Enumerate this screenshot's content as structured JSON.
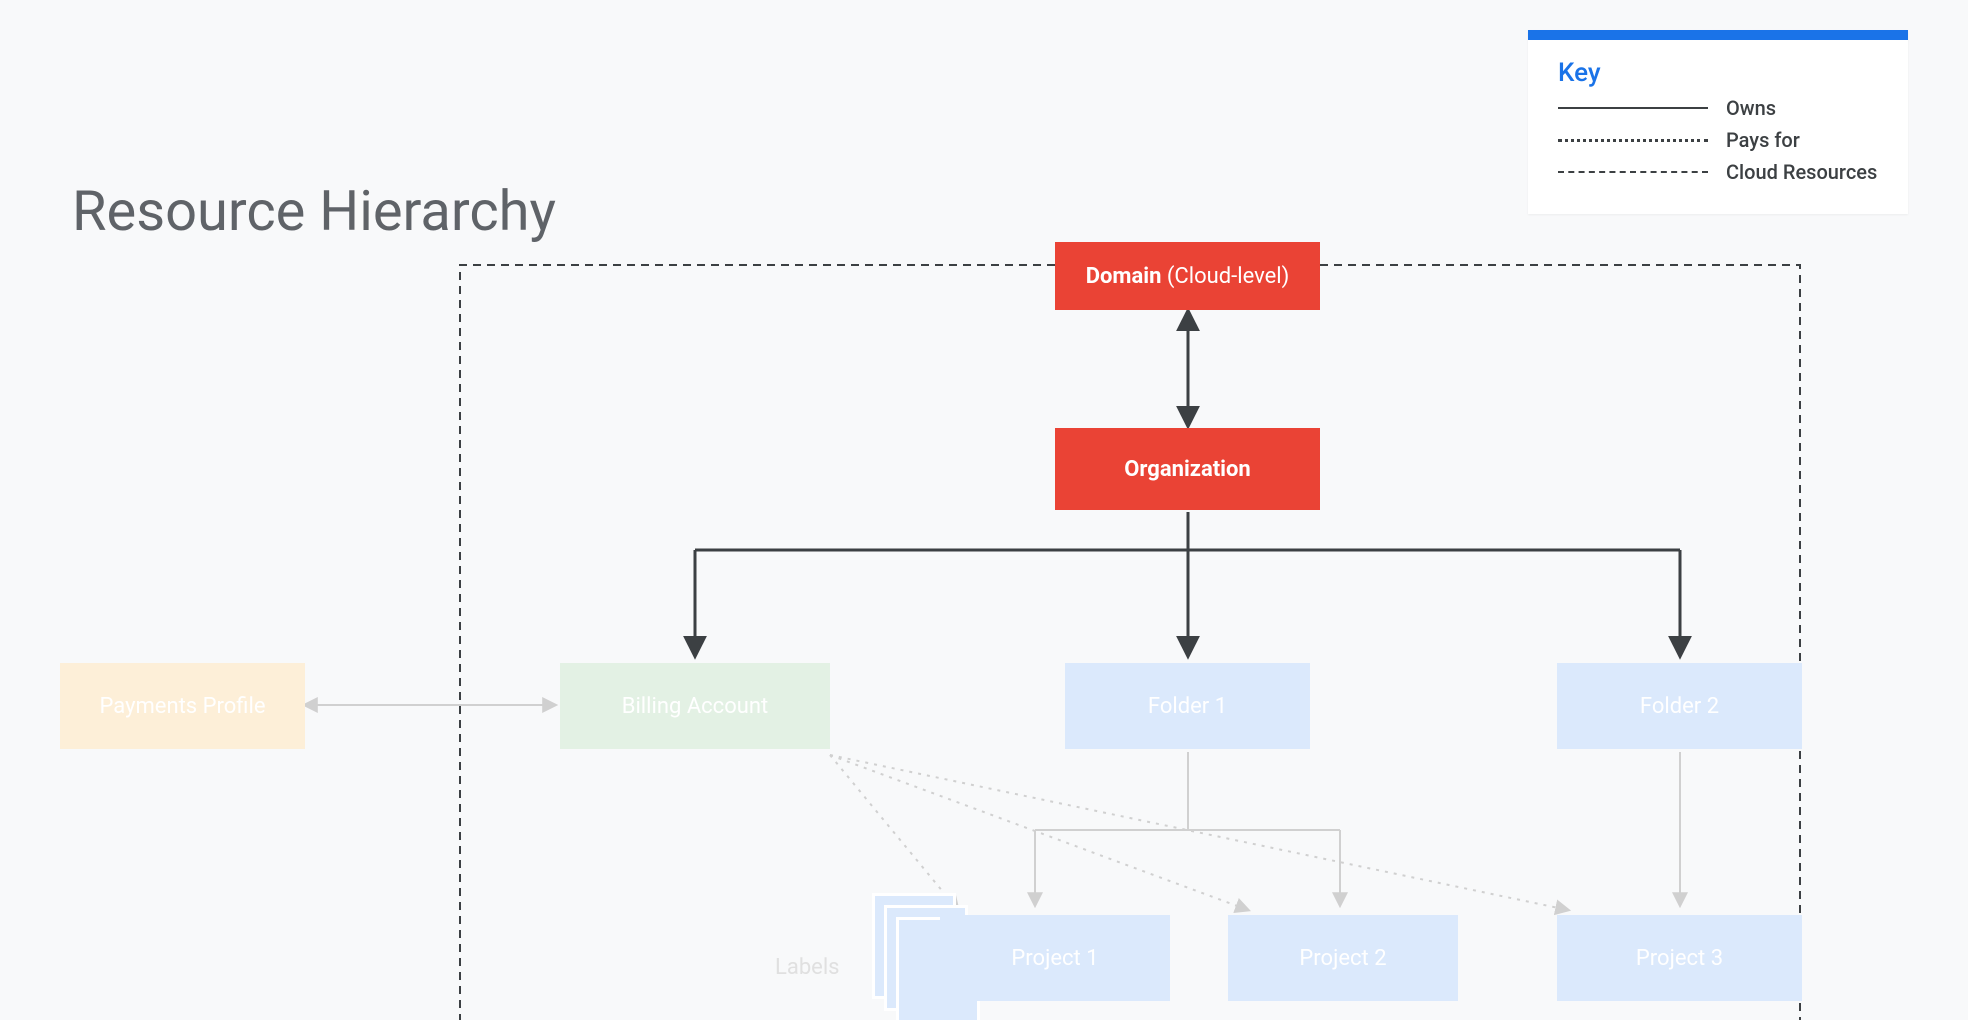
{
  "title": "Resource Hierarchy",
  "legend": {
    "title": "Key",
    "items": {
      "owns": "Owns",
      "pays": "Pays for",
      "cloud": "Cloud Resources"
    }
  },
  "nodes": {
    "domain_bold": "Domain",
    "domain_rest": " (Cloud-level)",
    "organization": "Organization",
    "payments_profile": "Payments Profile",
    "billing_account": "Billing Account",
    "folder1": "Folder 1",
    "folder2": "Folder 2",
    "project1": "Project 1",
    "project2": "Project 2",
    "project3": "Project 3",
    "labels": "Labels"
  }
}
